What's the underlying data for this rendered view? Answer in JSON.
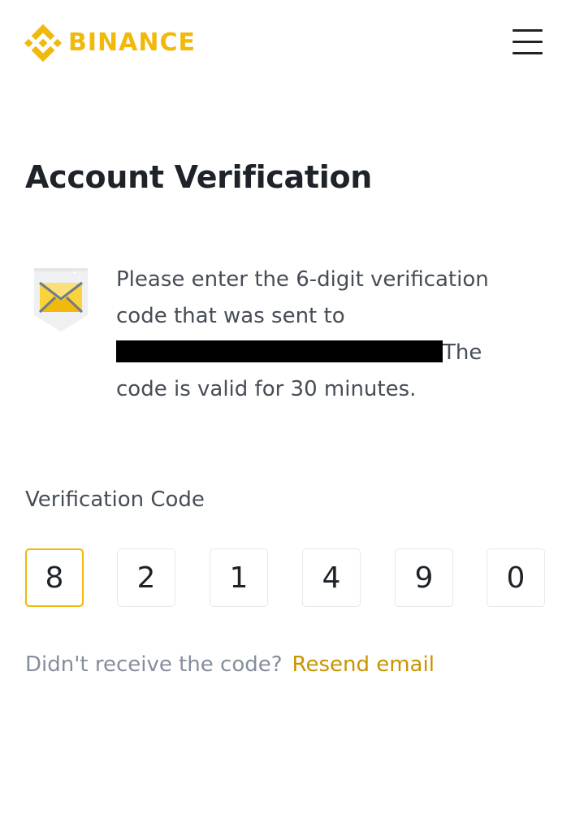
{
  "header": {
    "brand_name": "BINANCE",
    "brand_color": "#F0B90B",
    "menu_icon": "hamburger-menu-icon"
  },
  "page": {
    "title": "Account Verification"
  },
  "message": {
    "icon": "envelope-icon",
    "text_before": "Please enter the 6-digit verification code that was sent to",
    "email_redacted": true,
    "text_after": "The code is valid for 30 minutes."
  },
  "verification": {
    "label": "Verification Code",
    "digits": [
      "8",
      "2",
      "1",
      "4",
      "9",
      "0"
    ],
    "active_index": 0,
    "active_border_color": "#F0B90B"
  },
  "resend": {
    "prompt": "Didn't receive the code?",
    "link_label": "Resend email",
    "link_color": "#C99400"
  }
}
